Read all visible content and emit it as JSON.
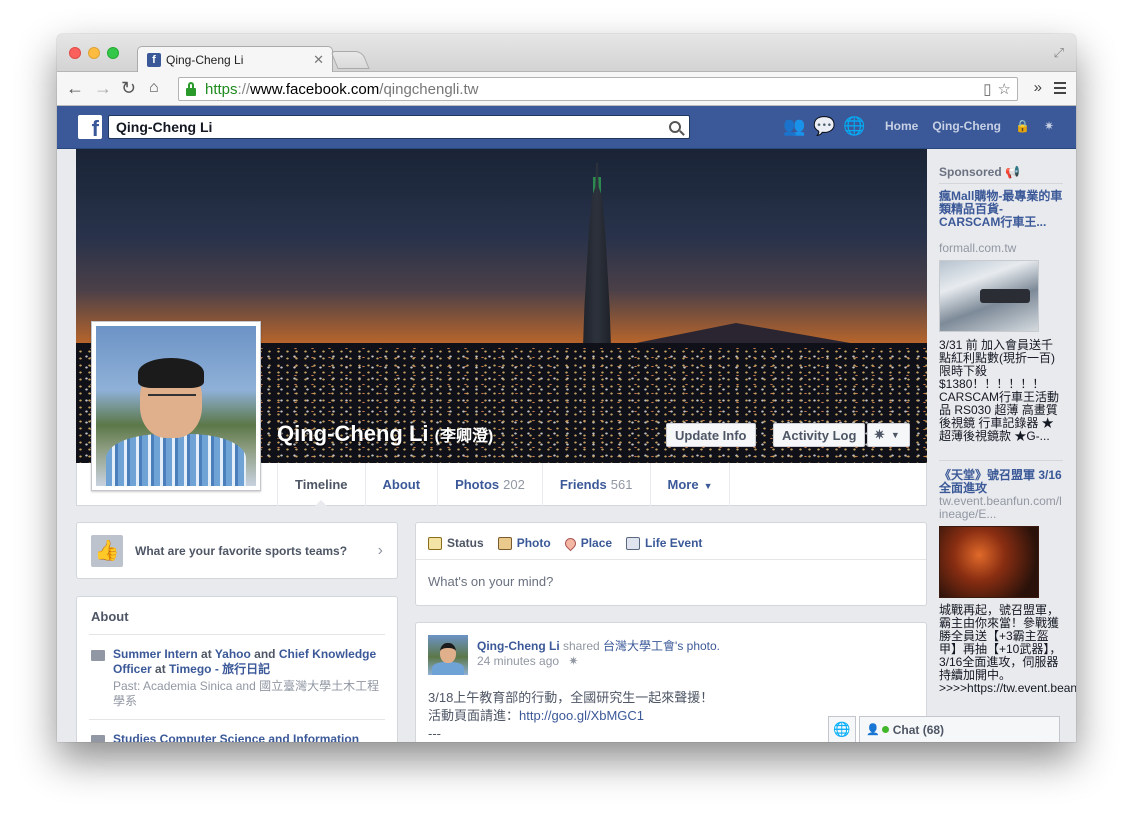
{
  "browser": {
    "tab_title": "Qing-Cheng Li",
    "tab_favicon": "f",
    "url_scheme": "https",
    "url_sep": "://",
    "url_host": "www.facebook.com",
    "url_path": "/qingchengli.tw"
  },
  "fbbar": {
    "search_value": "Qing-Cheng Li",
    "nav_home": "Home",
    "nav_profile": "Qing-Cheng"
  },
  "profile": {
    "name": "Qing-Cheng Li",
    "alt_name": "(李卿澄)",
    "update_info": "Update Info",
    "activity_log": "Activity Log"
  },
  "tabs": [
    {
      "label": "Timeline",
      "count": ""
    },
    {
      "label": "About",
      "count": ""
    },
    {
      "label": "Photos",
      "count": "202"
    },
    {
      "label": "Friends",
      "count": "561"
    },
    {
      "label": "More",
      "count": ""
    }
  ],
  "sports_prompt": "What are your favorite sports teams?",
  "about": {
    "title": "About",
    "items": [
      {
        "role1": "Summer Intern",
        "at1": " at ",
        "org1": "Yahoo",
        "and": " and ",
        "role2": "Chief Knowledge Officer",
        "at2": " at ",
        "org2": "Timego - 旅行日記",
        "past_prefix": "Past: ",
        "past1": "Academia Sinica",
        "past_and": " and ",
        "past2": "國立臺灣大學土木工程學系"
      },
      {
        "text": "Studies Computer Science and Information"
      }
    ]
  },
  "composer": {
    "tabs": [
      "Status",
      "Photo",
      "Place",
      "Life Event"
    ],
    "placeholder": "What's on your mind?"
  },
  "post": {
    "author": "Qing-Cheng Li",
    "shared": " shared ",
    "page": "台灣大學工會",
    "suffix": "'s photo.",
    "time": "24 minutes ago",
    "line1": "3/18上午教育部的行動，全國研究生一起來聲援！",
    "line2_prefix": "活動頁面請進：",
    "line2_url": "http://goo.gl/XbMGC1",
    "line3": "---"
  },
  "sidebar": {
    "title": "Sponsored",
    "ads": [
      {
        "title": "瘋Mall購物-最專業的車類精品百貨-CARSCAM行車王...",
        "domain": "formall.com.tw",
        "text": "3/31 前 加入會員送千點紅利點數(現折一百) 限時下殺 $1380！！！！！！CARSCAM行車王活動品 RS030 超薄 高畫質後視鏡 行車記錄器 ★超薄後視鏡款 ★G-..."
      },
      {
        "title": "《天堂》號召盟軍 3/16全面進攻",
        "domain": "tw.event.beanfun.com/lineage/E...",
        "text": "城戰再起，號召盟軍，霸主由你來當！參戰獲勝全員送【+3霸主盔甲】再抽【+10武器】，3/16全面進攻，伺服器持續加開中。>>>>https://tw.event.beanfun.c..."
      }
    ]
  },
  "chat": {
    "label": "Chat (68)"
  }
}
